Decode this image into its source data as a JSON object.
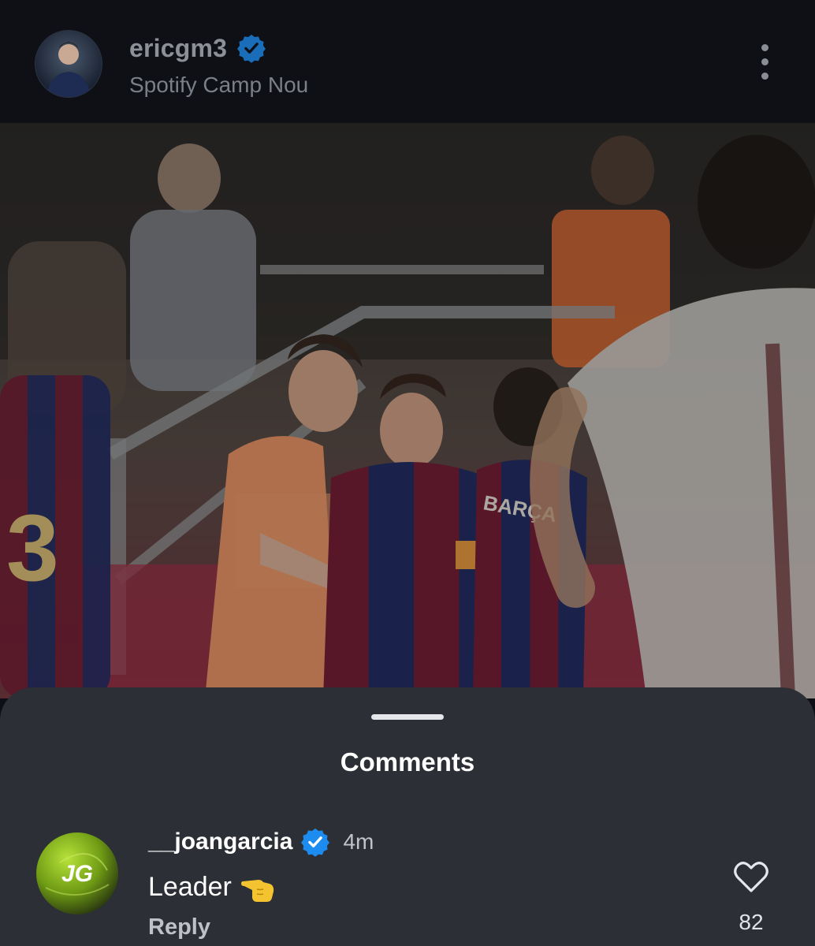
{
  "post": {
    "username": "ericgm3",
    "location": "Spotify Camp Nou",
    "photo_jersey_text": "BARÇA"
  },
  "icons": {
    "verified": "verified-badge-icon",
    "more": "more-vertical-icon",
    "like": "heart-outline-icon",
    "emoji": "backhand-index-pointing-left-emoji"
  },
  "colors": {
    "verified_blue": "#1d8cf0",
    "sheet_bg": "#2c2f36",
    "header_bg": "#0e1016"
  },
  "comments": {
    "title": "Comments",
    "items": [
      {
        "username": "__joangarcia",
        "time": "4m",
        "text": "Leader",
        "reply_label": "Reply",
        "likes": "82",
        "avatar_monogram": "JG"
      }
    ]
  }
}
